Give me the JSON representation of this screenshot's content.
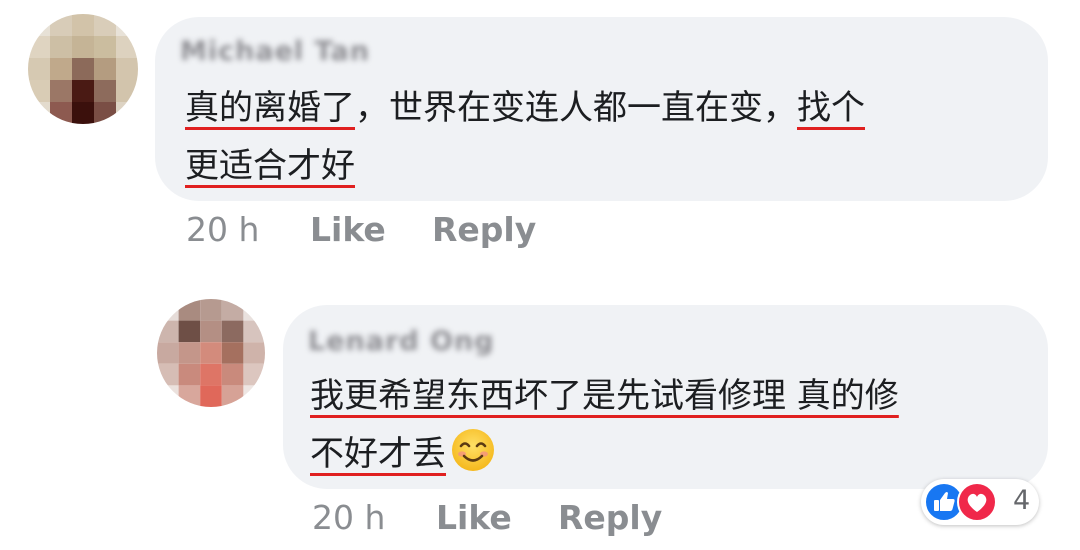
{
  "comments": [
    {
      "author": "Michael Tan",
      "text_parts": {
        "p1": "真的离婚了",
        "p2": "，世界在变连人都一直在变，",
        "p3": "找个",
        "p4": "更适合才好"
      },
      "time": "20 h",
      "like_label": "Like",
      "reply_label": "Reply"
    },
    {
      "author": "Lenard Ong",
      "text_parts": {
        "p1": "我更希望东西坏了是先试看修理 真的修",
        "p2": "不好才丢"
      },
      "emoji": "smiling-face-icon",
      "time": "20 h",
      "like_label": "Like",
      "reply_label": "Reply",
      "reactions": {
        "types": [
          "like",
          "love"
        ],
        "count": "4"
      }
    }
  ],
  "colors": {
    "bubble": "#f0f2f5",
    "underline": "#e02020",
    "action_text": "#8a8d91",
    "like_blue": "#1877f2",
    "love_red": "#f0284a"
  }
}
